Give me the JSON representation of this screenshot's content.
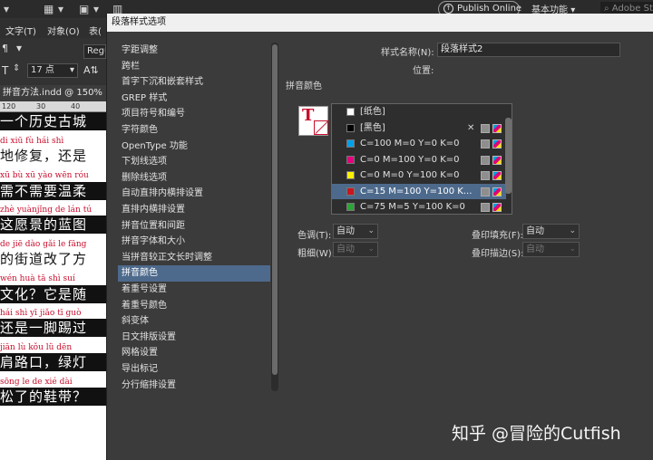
{
  "app": {
    "publish_label": "Publish Online",
    "workspace_label": "基本功能",
    "search_placeholder": "Adobe St"
  },
  "menubar": {
    "items": [
      "文字(T)",
      "对象(O)",
      "表("
    ]
  },
  "controlbar": {
    "font_field": "Regu",
    "size_value": "17 点"
  },
  "document": {
    "tab_label": "拼音方法.indd @ 150%",
    "ruler": [
      "120",
      "30",
      "40"
    ],
    "lines": [
      {
        "kind": "hanzi",
        "style": "dark",
        "text": "一个历史古城"
      },
      {
        "kind": "pinyin",
        "text": "di  xiū  fù      hái  shì"
      },
      {
        "kind": "hanzi",
        "style": "light",
        "text": "地修复，还是"
      },
      {
        "kind": "pinyin",
        "text": "xū  bù  xū  yào wēn róu"
      },
      {
        "kind": "hanzi",
        "style": "dark",
        "text": "需不需要温柔"
      },
      {
        "kind": "pinyin",
        "text": "zhè yuànjǐng de lán  tú"
      },
      {
        "kind": "hanzi",
        "style": "dark",
        "text": "这愿景的蓝图"
      },
      {
        "kind": "pinyin",
        "text": "de  jiē dào gǎi  le fāng"
      },
      {
        "kind": "hanzi",
        "style": "light",
        "text": "的街道改了方"
      },
      {
        "kind": "pinyin",
        "text": "wén huà         tā  shì suí"
      },
      {
        "kind": "hanzi",
        "style": "dark",
        "text": "文化？它是随"
      },
      {
        "kind": "pinyin",
        "text": "hái shì  yī  jiǎo  tī  guò"
      },
      {
        "kind": "hanzi",
        "style": "dark",
        "text": "还是一脚踢过"
      },
      {
        "kind": "pinyin",
        "text": "jiān lù  kǒu      lǜ  dēn"
      },
      {
        "kind": "hanzi",
        "style": "dark",
        "text": "肩路口，绿灯"
      },
      {
        "kind": "pinyin",
        "text": "sōng le   de  xié dài"
      },
      {
        "kind": "hanzi",
        "style": "dark",
        "text": "松了的鞋带？"
      }
    ]
  },
  "dialog": {
    "title": "段落样式选项",
    "categories": [
      "字距调整",
      "跨栏",
      "首字下沉和嵌套样式",
      "GREP 样式",
      "项目符号和编号",
      "字符颜色",
      "OpenType 功能",
      "下划线选项",
      "删除线选项",
      "自动直排内横排设置",
      "直排内横排设置",
      "拼音位置和间距",
      "拼音字体和大小",
      "当拼音较正文长时调整",
      "拼音颜色",
      "着重号设置",
      "着重号颜色",
      "斜变体",
      "日文排版设置",
      "网格设置",
      "导出标记",
      "分行缩排设置"
    ],
    "selected_category_index": 14,
    "style_name_label": "样式名称(N):",
    "style_name_value": "段落样式2",
    "position_label": "位置:",
    "section_title": "拼音颜色",
    "swatches": [
      {
        "name": "[纸色]",
        "color": "#ffffff",
        "locked": false,
        "cmyk": false
      },
      {
        "name": "[黑色]",
        "color": "#000000",
        "locked": true,
        "cmyk": true
      },
      {
        "name": "C=100 M=0 Y=0 K=0",
        "color": "#00a0e9",
        "locked": false,
        "cmyk": true
      },
      {
        "name": "C=0 M=100 Y=0 K=0",
        "color": "#e4007f",
        "locked": false,
        "cmyk": true
      },
      {
        "name": "C=0 M=0 Y=100 K=0",
        "color": "#fff100",
        "locked": false,
        "cmyk": true
      },
      {
        "name": "C=15 M=100 Y=100 K...",
        "color": "#c8161e",
        "locked": false,
        "cmyk": true
      },
      {
        "name": "C=75 M=5 Y=100 K=0",
        "color": "#2ea338",
        "locked": false,
        "cmyk": true
      }
    ],
    "selected_swatch_index": 5,
    "tint_label": "色调(T):",
    "tint_value": "自动",
    "weight_label": "粗细(W):",
    "weight_value": "自动",
    "overprint_fill_label": "叠印填充(F):",
    "overprint_fill_value": "自动",
    "overprint_stroke_label": "叠印描边(S):",
    "overprint_stroke_value": "自动"
  },
  "watermark": "知乎 @冒险的Cutfish"
}
